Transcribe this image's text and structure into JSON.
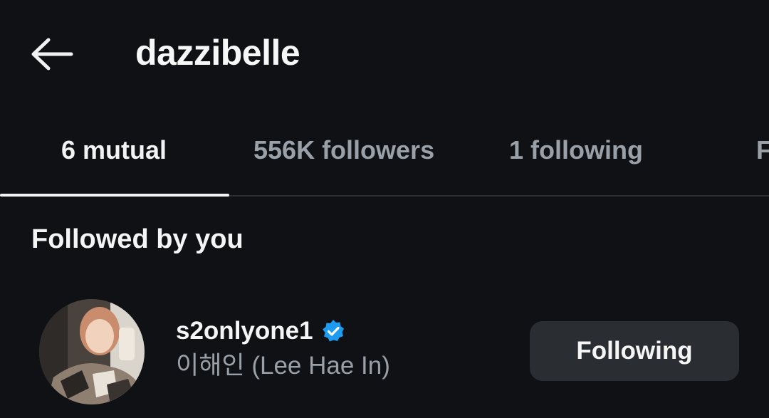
{
  "header": {
    "back_icon": "arrow-left-icon",
    "title": "dazzibelle"
  },
  "tabs": [
    {
      "label": "6 mutual",
      "active": true
    },
    {
      "label": "556K followers",
      "active": false
    },
    {
      "label": "1 following",
      "active": false
    },
    {
      "label": "F",
      "active": false
    }
  ],
  "section": {
    "title": "Followed by you"
  },
  "users": [
    {
      "username": "s2onlyone1",
      "verified": true,
      "verified_icon": "verified-badge-icon",
      "display_name": "이해인 (Lee Hae In)",
      "button_label": "Following"
    }
  ],
  "colors": {
    "background": "#0f1115",
    "accent_verified": "#1d9bf0",
    "muted_text": "#9aa0a8",
    "button_bg": "#2a2d32"
  }
}
